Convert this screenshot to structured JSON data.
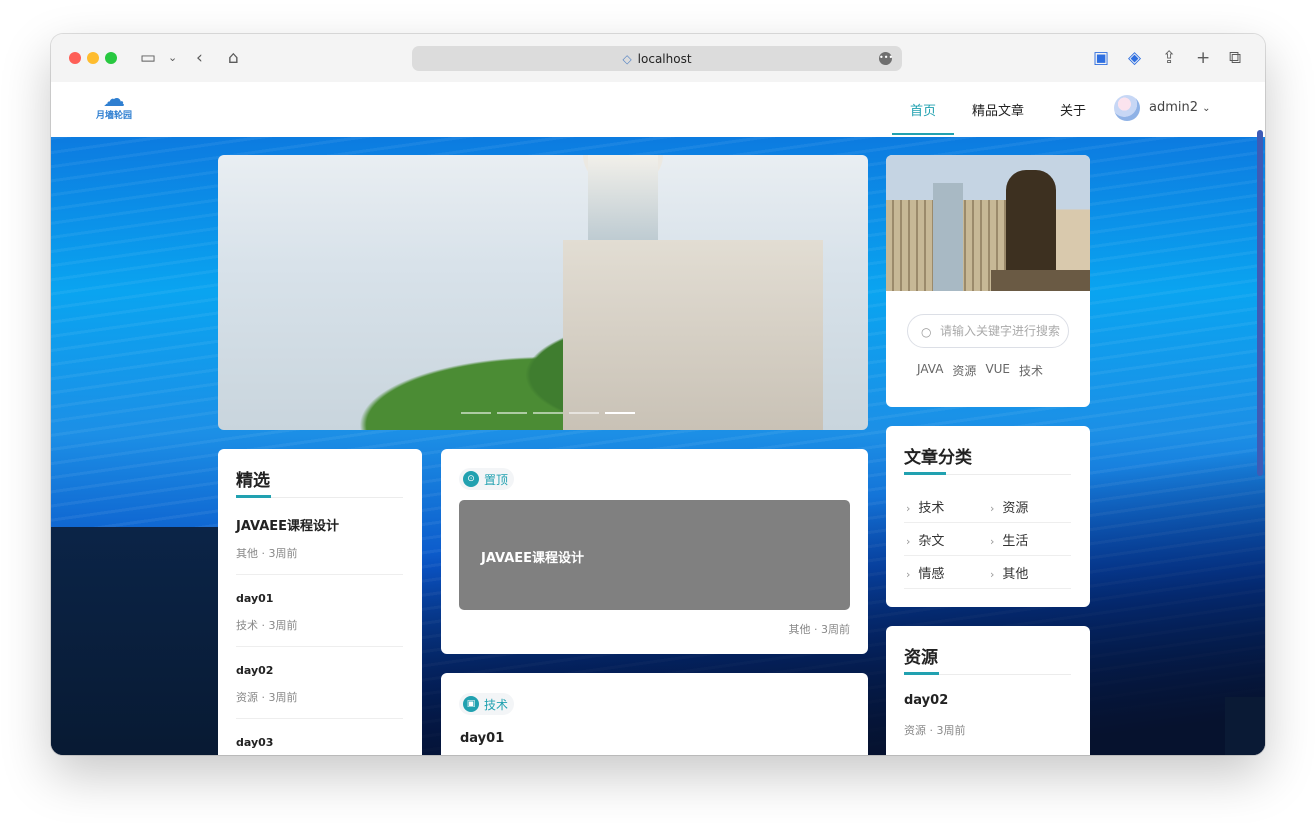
{
  "browser": {
    "url": "localhost",
    "icons": [
      "sidebar-icon",
      "chevron-down-icon",
      "back-icon",
      "home-icon",
      "extension-icon",
      "shield-icon",
      "share-icon",
      "new-tab-icon",
      "tabs-icon"
    ]
  },
  "nav": {
    "logo_text": "月墙轮园",
    "items": [
      "首页",
      "精品文章",
      "关于"
    ],
    "user": "admin2",
    "accent": "#21a1b0"
  },
  "sidebar": {
    "search_placeholder": "请输入关键字进行搜索",
    "tags": [
      "JAVA",
      "资源",
      "VUE",
      "技术"
    ],
    "category_title": "文章分类",
    "categories": [
      "技术",
      "资源",
      "杂文",
      "生活",
      "情感",
      "其他"
    ],
    "resource_title": "资源",
    "resource_item": {
      "title": "day02",
      "meta": "资源 · 3周前"
    }
  },
  "featured": {
    "title": "精选",
    "items": [
      {
        "title": "JAVAEE课程设计",
        "meta": "其他 · 3周前"
      },
      {
        "title": "day01",
        "meta": "技术 · 3周前"
      },
      {
        "title": "day02",
        "meta": "资源 · 3周前"
      },
      {
        "title": "day03",
        "meta": ""
      }
    ]
  },
  "posts": [
    {
      "tag": "置顶",
      "cover_title": "JAVAEE课程设计",
      "meta": "其他 · 3周前"
    },
    {
      "tag": "技术",
      "title": "day01"
    }
  ]
}
